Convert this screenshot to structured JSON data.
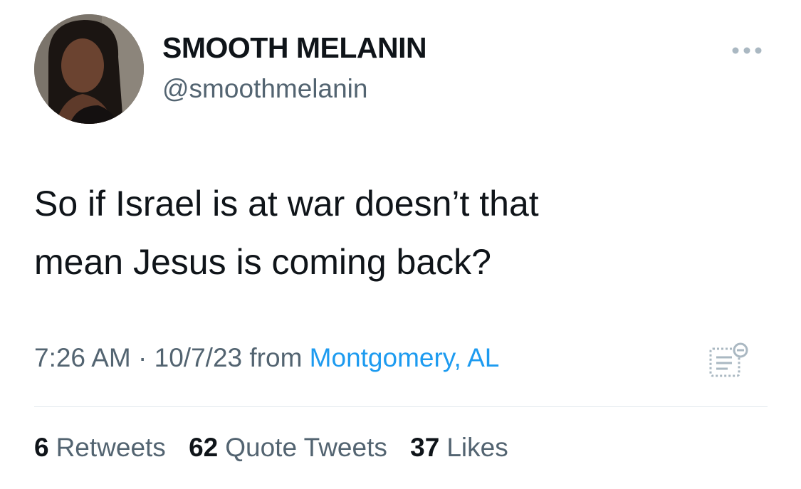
{
  "tweet": {
    "author": {
      "display_name": "SMOOTH MELANIN",
      "handle": "@smoothmelanin"
    },
    "text_lines": [
      "So if Israel is at war doesn’t that",
      "mean Jesus is coming back?"
    ],
    "time": "7:26 AM",
    "separator": "·",
    "date": "10/7/23",
    "from_label": "from",
    "location": "Montgomery, AL",
    "stats": {
      "retweets": {
        "count": "6",
        "label": "Retweets"
      },
      "quote_tweets": {
        "count": "62",
        "label": "Quote Tweets"
      },
      "likes": {
        "count": "37",
        "label": "Likes"
      }
    },
    "icons": {
      "more": "more-horizontal-icon",
      "analytics": "view-analytics-icon"
    }
  },
  "colors": {
    "text_primary": "#0f1419",
    "text_secondary": "#536471",
    "link": "#1d9bf0",
    "divider": "#e1e8ed",
    "icon_gray": "#aab8c2"
  }
}
